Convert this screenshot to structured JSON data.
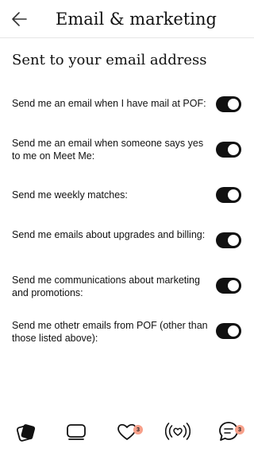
{
  "header": {
    "title": "Email & marketing",
    "back_icon": "arrow-left-icon"
  },
  "section": {
    "title": "Sent to your email address"
  },
  "settings": [
    {
      "label": "Send me an email when I have mail at POF:",
      "enabled": true
    },
    {
      "label": "Send me an email when someone says yes to me on Meet Me:",
      "enabled": true
    },
    {
      "label": "Send me weekly matches:",
      "enabled": true
    },
    {
      "label": "Send me emails about upgrades and billing:",
      "enabled": true
    },
    {
      "label": "Send me communications about marketing and promotions:",
      "enabled": true
    },
    {
      "label": "Send me othetr emails from POF (other than those listed above):",
      "enabled": true
    }
  ],
  "tabbar": {
    "tabs": [
      {
        "icon": "cards-icon",
        "active": true
      },
      {
        "icon": "stack-icon",
        "active": false
      },
      {
        "icon": "heart-icon",
        "active": false,
        "badge": "3"
      },
      {
        "icon": "live-icon",
        "active": false
      },
      {
        "icon": "chat-icon",
        "active": false,
        "badge": "3"
      }
    ]
  },
  "colors": {
    "toggle_on": "#111111",
    "badge": "#f7a08a",
    "divider": "#e6e6e6"
  }
}
